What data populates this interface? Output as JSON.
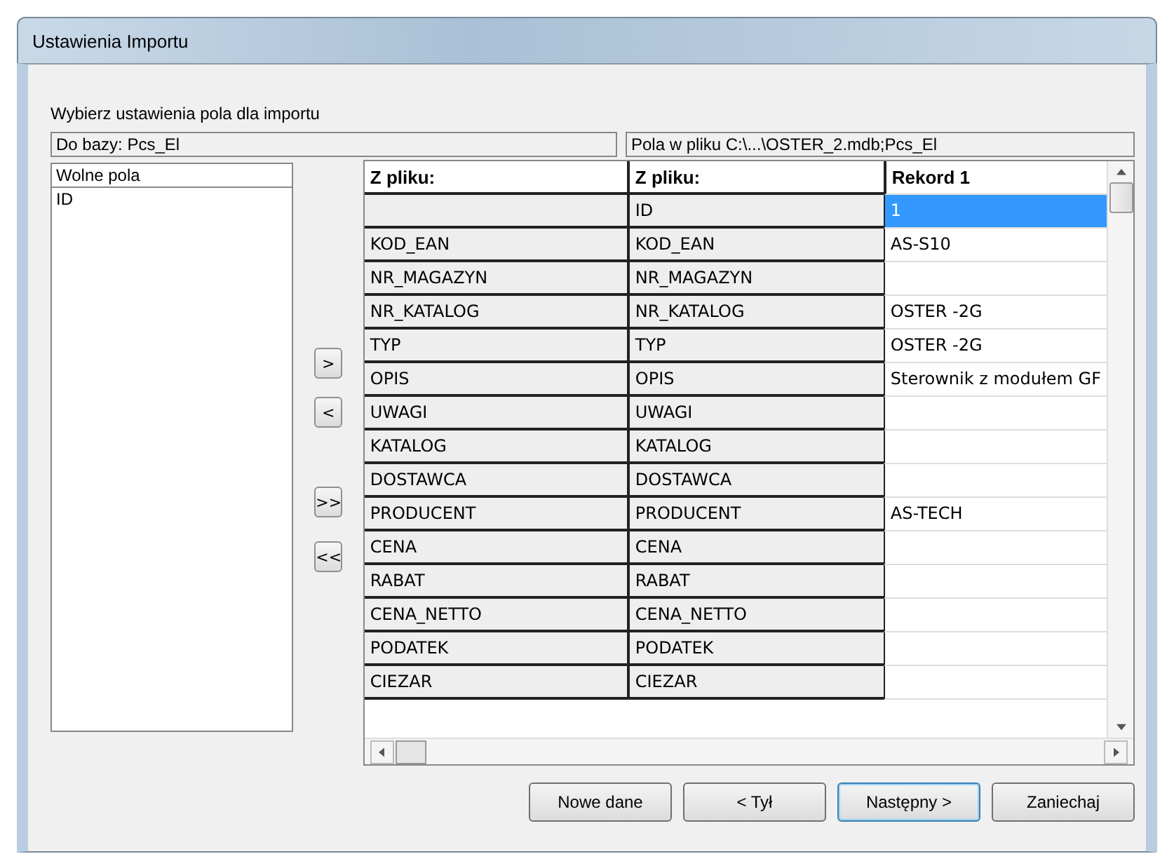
{
  "window": {
    "title": "Ustawienia Importu"
  },
  "instruction": "Wybierz ustawienia pola dla importu",
  "target_header": "Do bazy: Pcs_El",
  "source_header": "Pola w pliku C:\\...\\OSTER_2.mdb;Pcs_El",
  "free_fields": {
    "header": "Wolne pola",
    "items": [
      "ID"
    ]
  },
  "move_buttons": [
    ">",
    "<",
    ">>",
    "<<"
  ],
  "grid": {
    "columns": [
      "Z pliku:",
      "Z pliku:",
      "Rekord 1"
    ],
    "rows": [
      {
        "target": "",
        "source": "ID",
        "record": "1",
        "selected": true
      },
      {
        "target": "KOD_EAN",
        "source": "KOD_EAN",
        "record": "AS-S10",
        "selected": false
      },
      {
        "target": "NR_MAGAZYN",
        "source": "NR_MAGAZYN",
        "record": "",
        "selected": false
      },
      {
        "target": "NR_KATALOG",
        "source": "NR_KATALOG",
        "record": "OSTER -2G",
        "selected": false
      },
      {
        "target": "TYP",
        "source": "TYP",
        "record": "OSTER -2G",
        "selected": false
      },
      {
        "target": "OPIS",
        "source": "OPIS",
        "record": "Sterownik z modułem GF",
        "selected": false
      },
      {
        "target": "UWAGI",
        "source": "UWAGI",
        "record": "",
        "selected": false
      },
      {
        "target": "KATALOG",
        "source": "KATALOG",
        "record": "",
        "selected": false
      },
      {
        "target": "DOSTAWCA",
        "source": "DOSTAWCA",
        "record": "",
        "selected": false
      },
      {
        "target": "PRODUCENT",
        "source": "PRODUCENT",
        "record": "AS-TECH",
        "selected": false
      },
      {
        "target": "CENA",
        "source": "CENA",
        "record": "",
        "selected": false
      },
      {
        "target": "RABAT",
        "source": "RABAT",
        "record": "",
        "selected": false
      },
      {
        "target": "CENA_NETTO",
        "source": "CENA_NETTO",
        "record": "",
        "selected": false
      },
      {
        "target": "PODATEK",
        "source": "PODATEK",
        "record": "",
        "selected": false
      },
      {
        "target": "CIEZAR",
        "source": "CIEZAR",
        "record": "",
        "selected": false
      }
    ]
  },
  "buttons": [
    {
      "label": "Nowe dane",
      "kind": "normal"
    },
    {
      "label": "< Tył",
      "kind": "normal"
    },
    {
      "label": "Następny >",
      "kind": "default"
    },
    {
      "label": "Zaniechaj",
      "kind": "normal"
    }
  ]
}
